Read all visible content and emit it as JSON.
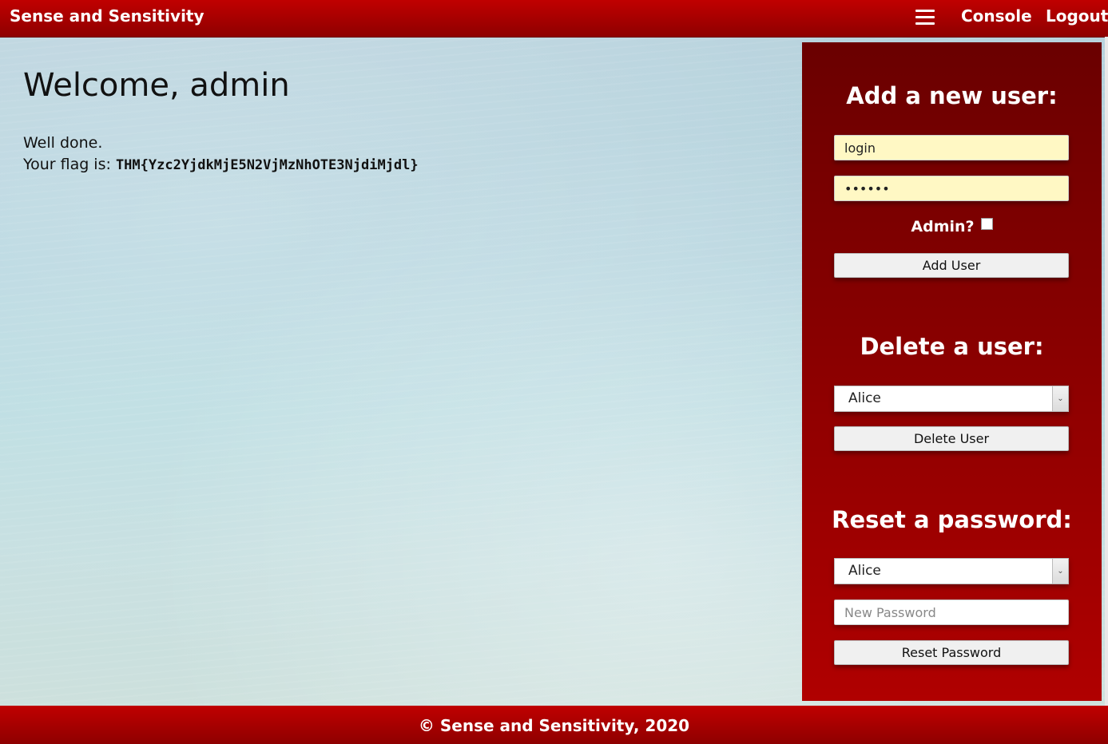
{
  "header": {
    "brand": "Sense and Sensitivity",
    "menu_icon": "hamburger-menu-icon",
    "nav": {
      "console": "Console",
      "logout": "Logout"
    }
  },
  "main": {
    "welcome": "Welcome, admin",
    "line1": "Well done.",
    "flag_label": "Your flag is: ",
    "flag_value": "THM{Yzc2YjdkMjE5N2VjMzNhOTE3NjdiMjdl}"
  },
  "panel": {
    "add_user": {
      "title": "Add a new user:",
      "login_value": "login",
      "password_value": "admin1",
      "admin_label": "Admin?",
      "admin_checked": false,
      "button": "Add User"
    },
    "delete_user": {
      "title": "Delete a user:",
      "selected": "Alice",
      "button": "Delete User"
    },
    "reset_password": {
      "title": "Reset a password:",
      "selected": "Alice",
      "new_password_placeholder": "New Password",
      "button": "Reset Password"
    }
  },
  "footer": {
    "text": "© Sense and Sensitivity, 2020"
  },
  "colors": {
    "header_red": "#c00000",
    "panel_dark_red": "#6a0000",
    "input_yellow": "#fff8c4"
  }
}
